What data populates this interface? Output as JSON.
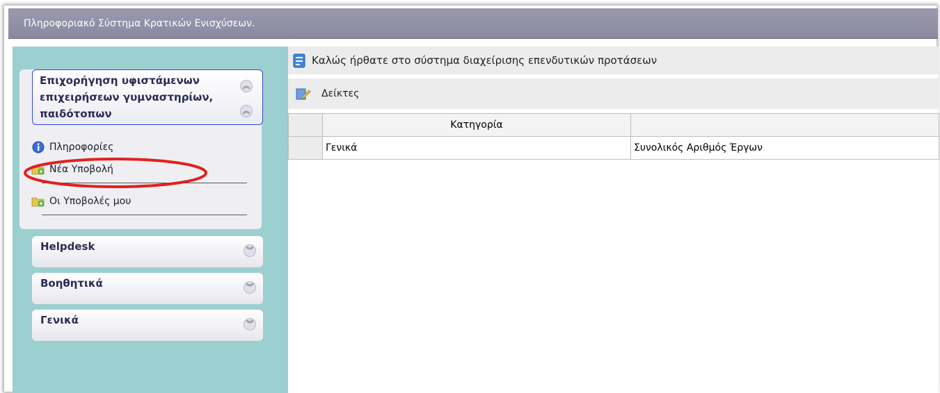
{
  "header": {
    "title": "Πληροφοριακό Σύστημα Κρατικών Ενισχύσεων."
  },
  "sidebar": {
    "active_panel": {
      "title": "Επιχορήγηση υφιστάμενων επιχειρήσεων γυμναστηρίων, παιδότοπων",
      "items": [
        {
          "label": "Πληροφορίες",
          "icon": "info-icon"
        },
        {
          "label": "Νέα Υποβολή",
          "icon": "folder-add-icon"
        },
        {
          "label": "Οι Υποβολές μου",
          "icon": "folder-add-icon"
        }
      ]
    },
    "collapsed_panels": [
      {
        "title": "Helpdesk"
      },
      {
        "title": "Βοηθητικά"
      },
      {
        "title": "Γενικά"
      }
    ]
  },
  "main": {
    "welcome": "Καλώς ήρθατε στο σύστημα διαχείρισης επενδυτικών προτάσεων",
    "tab": "Δείκτες",
    "table": {
      "headers": [
        "",
        "Κατηγορία",
        ""
      ],
      "rows": [
        [
          "",
          "Γενικά",
          "Συνολικός Αριθμός Έργων"
        ]
      ]
    }
  },
  "colors": {
    "header_bg": "#9190a6",
    "sidebar_bg": "#9ccfcf",
    "accent_border": "#2e48d6",
    "annotation": "#e0201f"
  }
}
